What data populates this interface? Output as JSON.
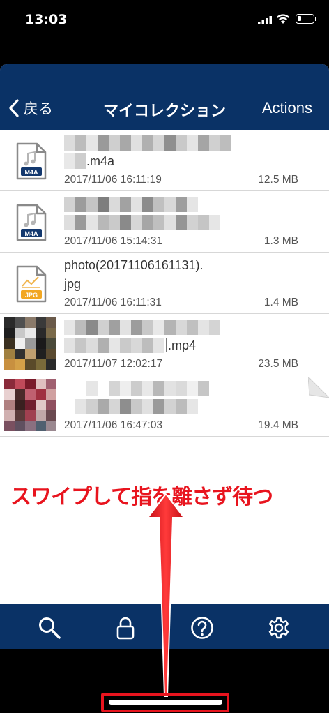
{
  "status_bar": {
    "time": "13:03"
  },
  "navbar": {
    "back_label": "戻る",
    "title": "マイコレクション",
    "actions_label": "Actions",
    "color": "#0a3266"
  },
  "files": [
    {
      "name_line1": "",
      "name_line2": ".m4a",
      "date": "2017/11/06 16:11:19",
      "size": "12.5 MB",
      "icon": "m4a-file-icon",
      "badge": "M4A"
    },
    {
      "name_line1": "",
      "name_line2": "",
      "date": "2017/11/06 15:14:31",
      "size": "1.3 MB",
      "icon": "m4a-file-icon",
      "badge": "M4A"
    },
    {
      "name_line1": "photo(20171106161131).",
      "name_line2": "jpg",
      "date": "2017/11/06 16:11:31",
      "size": "1.4 MB",
      "icon": "jpg-file-icon",
      "badge": "JPG"
    },
    {
      "name_line1": "",
      "name_line2": ".mp4",
      "date": "2017/11/07 12:02:17",
      "size": "23.5 MB",
      "icon": "video-thumbnail",
      "badge": ""
    },
    {
      "name_line1": "",
      "name_line2": "",
      "date": "2017/11/06 16:47:03",
      "size": "19.4 MB",
      "icon": "photo-thumbnail",
      "badge": ""
    }
  ],
  "annotation": {
    "text": "スワイプして指を離さず待つ",
    "color": "#e8141e"
  },
  "tabbar": {
    "tabs": [
      "search-icon",
      "lock-icon",
      "help-icon",
      "gear-icon"
    ]
  }
}
